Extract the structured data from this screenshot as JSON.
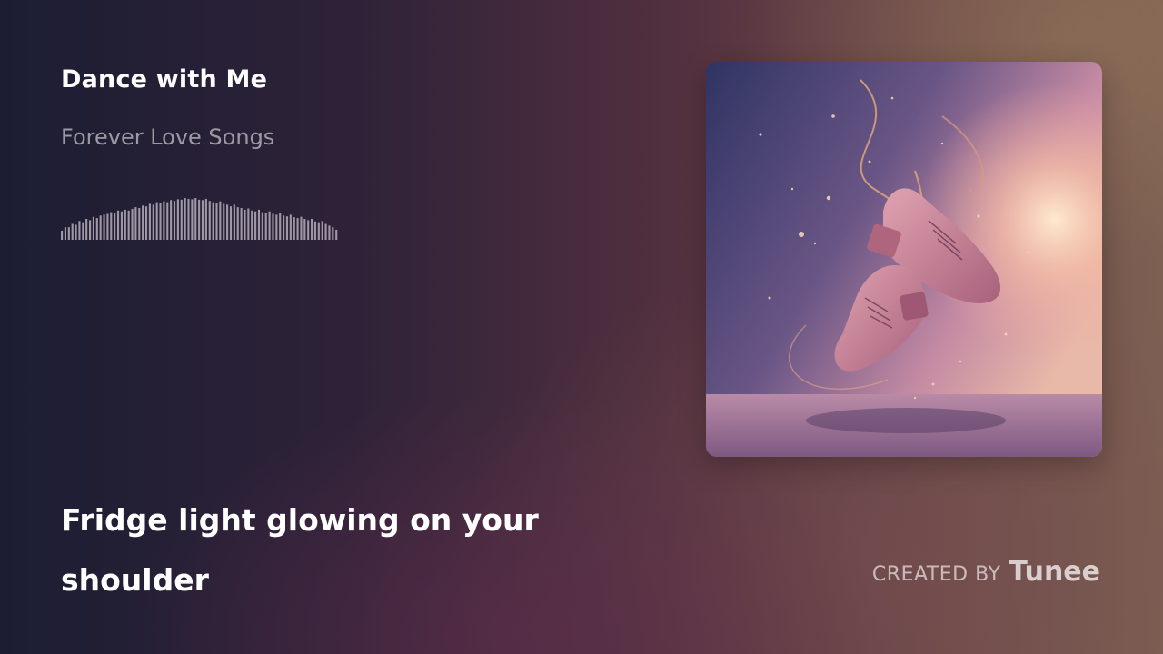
{
  "track": {
    "title": "Dance with Me",
    "album": "Forever Love Songs"
  },
  "waveform": {
    "color": "#9f98a4",
    "levels": [
      0.22,
      0.3,
      0.3,
      0.38,
      0.36,
      0.45,
      0.42,
      0.5,
      0.47,
      0.55,
      0.52,
      0.58,
      0.6,
      0.62,
      0.66,
      0.65,
      0.7,
      0.68,
      0.72,
      0.7,
      0.74,
      0.78,
      0.76,
      0.82,
      0.8,
      0.86,
      0.84,
      0.9,
      0.88,
      0.92,
      0.9,
      0.95,
      0.93,
      0.97,
      0.96,
      1.0,
      0.98,
      0.97,
      1.0,
      0.96,
      0.95,
      0.98,
      0.93,
      0.9,
      0.88,
      0.92,
      0.86,
      0.84,
      0.8,
      0.84,
      0.78,
      0.76,
      0.72,
      0.75,
      0.7,
      0.68,
      0.72,
      0.66,
      0.64,
      0.68,
      0.62,
      0.6,
      0.63,
      0.58,
      0.56,
      0.6,
      0.54,
      0.52,
      0.55,
      0.5,
      0.47,
      0.5,
      0.44,
      0.42,
      0.45,
      0.38,
      0.34,
      0.3,
      0.24
    ]
  },
  "cover": {
    "description_icon": "album-cover-image",
    "palette": {
      "sky_top": "#3a3a6a",
      "sky_mid": "#8a6a9a",
      "glow": "#ffd2b0",
      "floor": "#9c6d8e",
      "shoe": "#c9869a",
      "shoe_dark": "#8e5470"
    }
  },
  "lyrics": {
    "current_line": "Fridge light glowing on your shoulder"
  },
  "credit": {
    "label": "CREATED BY",
    "brand": "Tunee"
  }
}
